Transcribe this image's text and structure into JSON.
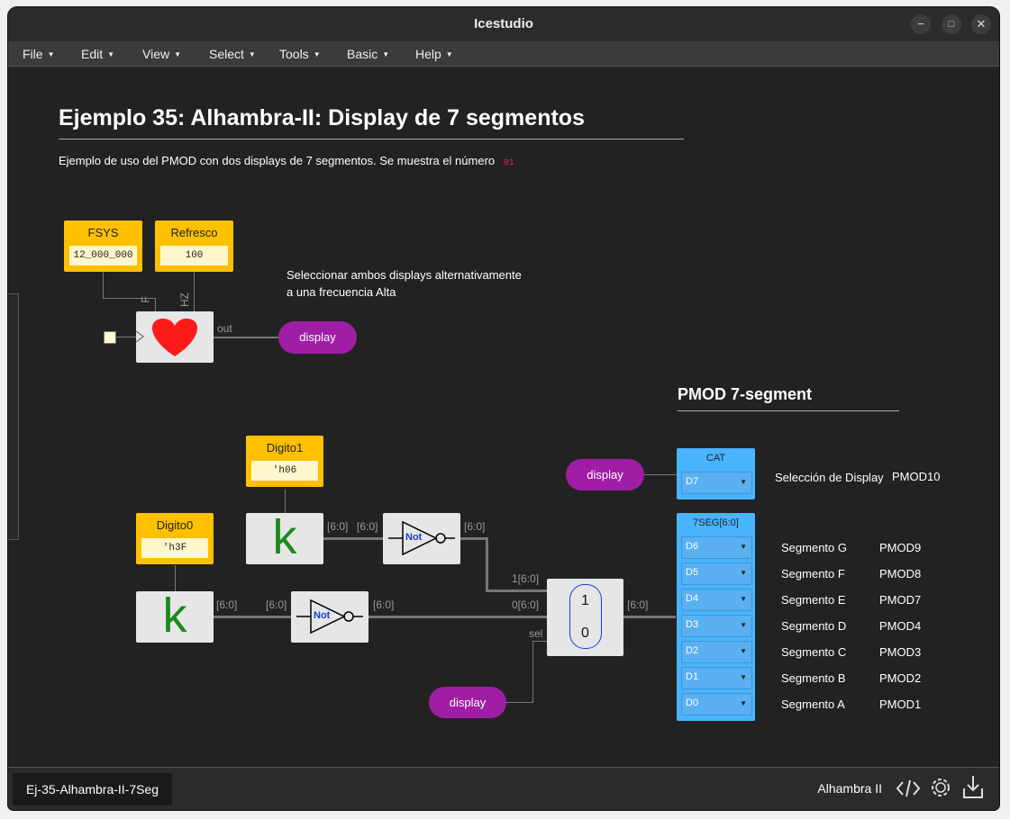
{
  "window": {
    "title": "Icestudio"
  },
  "menu": [
    "File",
    "Edit",
    "View",
    "Select",
    "Tools",
    "Basic",
    "Help"
  ],
  "heading": "Ejemplo 35: Alhambra-II: Display de 7 segmentos",
  "subtitle": "Ejemplo de uso del PMOD con dos displays de 7 segmentos. Se muestra el número",
  "subtitle_number": "01",
  "comment1": "Seleccionar ambos displays alternativamente",
  "comment2": "a una frecuencia Alta",
  "constants": {
    "fsys": {
      "label": "FSYS",
      "value": "12_000_000"
    },
    "refresco": {
      "label": "Refresco",
      "value": "100"
    },
    "digito1": {
      "label": "Digito1",
      "value": "'h06"
    },
    "digito0": {
      "label": "Digito0",
      "value": "'h3F"
    }
  },
  "heart_ports": {
    "f": "F",
    "hz": "HZ",
    "out": "out"
  },
  "labels": {
    "display": "display",
    "k": "k",
    "not": "Not",
    "bus": "[6:0]",
    "mux_in1": "1[6:0]",
    "mux_in0": "0[6:0]",
    "sel": "sel",
    "mux_1": "1",
    "mux_0": "0"
  },
  "pmod_title": "PMOD 7-segment",
  "cat": {
    "header": "CAT",
    "pin": "D7",
    "desc": "Selección de Display",
    "pmod": "PMOD10"
  },
  "seg": {
    "header": "7SEG[6:0]",
    "rows": [
      {
        "pin": "D6",
        "desc": "Segmento G",
        "pmod": "PMOD9"
      },
      {
        "pin": "D5",
        "desc": "Segmento F",
        "pmod": "PMOD8"
      },
      {
        "pin": "D4",
        "desc": "Segmento E",
        "pmod": "PMOD7"
      },
      {
        "pin": "D3",
        "desc": "Segmento D",
        "pmod": "PMOD4"
      },
      {
        "pin": "D2",
        "desc": "Segmento C",
        "pmod": "PMOD3"
      },
      {
        "pin": "D1",
        "desc": "Segmento B",
        "pmod": "PMOD2"
      },
      {
        "pin": "D0",
        "desc": "Segmento A",
        "pmod": "PMOD1"
      }
    ]
  },
  "bottom": {
    "tab": "Ej-35-Alhambra-II-7Seg",
    "board": "Alhambra II"
  },
  "icons": [
    "code-icon",
    "settings-icon",
    "download-icon"
  ],
  "colors": {
    "pill": "#a01ea6",
    "constant": "#ffc000",
    "pmod": "#4ab4ff",
    "k": "#1a8a1a",
    "heart": "#ff1a1a"
  }
}
